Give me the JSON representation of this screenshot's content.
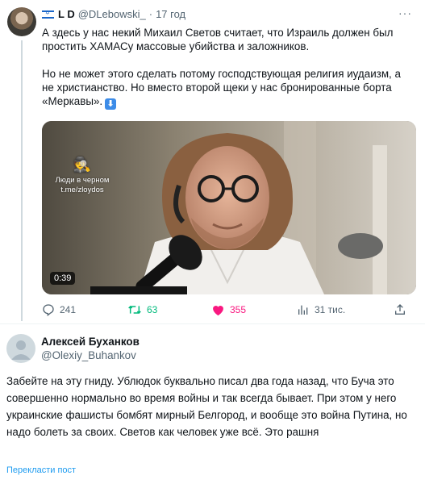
{
  "tweet1": {
    "author_name": "L D",
    "handle": "@DLebowski_",
    "separator": "·",
    "time": "17 год",
    "more": "···",
    "paragraph1": "А здесь у нас некий Михаил Светов считает, что Израиль должен был простить ХАМАСу массовые убийства и заложников.",
    "paragraph2": "Но не может этого сделать потому господствующая религия иудаизм, а не христианство. Но вместо второй щеки у нас бронированные борта «Меркавы».",
    "video": {
      "watermark_line1": "Люди в черном",
      "watermark_line2": "t.me/zloydos",
      "duration": "0:39"
    },
    "actions": {
      "replies": "241",
      "reposts": "63",
      "likes": "355",
      "views": "31 тис."
    }
  },
  "tweet2": {
    "author_name": "Алексей Буханков",
    "handle": "@Olexiy_Buhankov",
    "text": "Забейте на эту гниду. Ублюдок буквально писал два года назад, что Буча это совершенно нормально во время войны и так всегда бывает. При этом у него украинские фашисты бомбят мирный Белгород, и вообще это война Путина, но надо болеть за своих. Светов как человек уже всё. Это рашня",
    "translate_label": "Перекласти пост"
  },
  "colors": {
    "accent": "#1d9bf0",
    "repost": "#00ba7c",
    "like": "#f91880",
    "muted": "#536471"
  },
  "icons": [
    "israel-flag-icon",
    "more-icon",
    "down-arrow-icon",
    "reply-icon",
    "repost-icon",
    "heart-icon",
    "views-icon",
    "share-icon"
  ]
}
